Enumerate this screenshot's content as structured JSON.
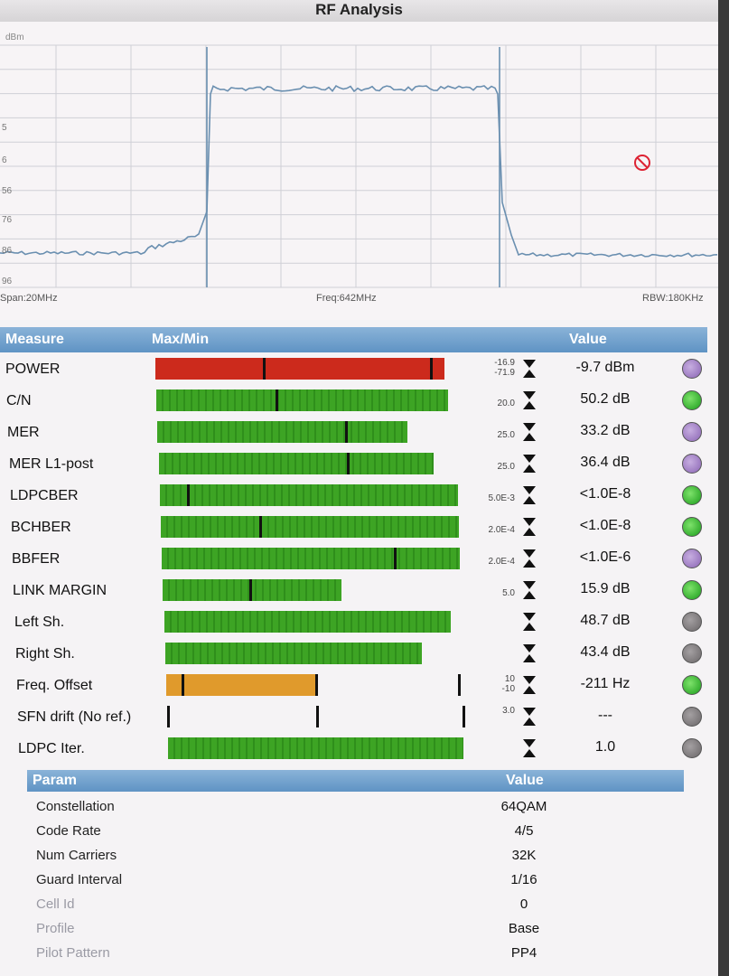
{
  "window_title": "RF Analysis",
  "spectrum": {
    "y_unit": "dBm",
    "y_ticks": [
      "5",
      "6",
      "56",
      "76",
      "86",
      "96"
    ],
    "span": "Span:20MHz",
    "freq": "Freq:642MHz",
    "rbw": "RBW:180KHz",
    "no_signal_icon": "prohibited-icon"
  },
  "measures": {
    "header": {
      "measure": "Measure",
      "maxmin": "Max/Min",
      "value": "Value"
    },
    "rows": [
      {
        "label": "POWER",
        "fill": 0.97,
        "color": "red",
        "markers": [
          0.36,
          0.92
        ],
        "max": "-16.9",
        "min": "-71.9",
        "value": "-9.7 dBm",
        "led": "purple"
      },
      {
        "label": "C/N",
        "fill": 0.98,
        "color": "green",
        "markers": [
          0.4
        ],
        "max": "",
        "min": "20.0",
        "value": "50.2 dB",
        "led": "green"
      },
      {
        "label": "MER",
        "fill": 0.84,
        "color": "green",
        "markers": [
          0.63
        ],
        "max": "",
        "min": "25.0",
        "value": "33.2 dB",
        "led": "purple"
      },
      {
        "label": "MER L1-post",
        "fill": 0.92,
        "color": "green",
        "markers": [
          0.63
        ],
        "max": "",
        "min": "25.0",
        "value": "36.4 dB",
        "led": "purple"
      },
      {
        "label": "LDPCBER",
        "fill": 1.0,
        "color": "green",
        "markers": [
          0.09
        ],
        "max": "",
        "min": "5.0E-3",
        "value": "<1.0E-8",
        "led": "green"
      },
      {
        "label": "BCHBER",
        "fill": 1.0,
        "color": "green",
        "markers": [
          0.33
        ],
        "max": "",
        "min": "2.0E-4",
        "value": "<1.0E-8",
        "led": "green"
      },
      {
        "label": "BBFER",
        "fill": 1.0,
        "color": "green",
        "markers": [
          0.78
        ],
        "max": "",
        "min": "2.0E-4",
        "value": "<1.0E-6",
        "led": "purple"
      },
      {
        "label": "LINK MARGIN",
        "fill": 0.6,
        "color": "green",
        "markers": [
          0.29
        ],
        "max": "",
        "min": "5.0",
        "value": "15.9 dB",
        "led": "green"
      },
      {
        "label": "Left Sh.",
        "fill": 0.96,
        "color": "green",
        "markers": [],
        "max": "",
        "min": "",
        "value": "48.7 dB",
        "led": "gray"
      },
      {
        "label": "Right Sh.",
        "fill": 0.86,
        "color": "green",
        "markers": [],
        "max": "",
        "min": "",
        "value": "43.4 dB",
        "led": "gray"
      },
      {
        "label": "Freq. Offset",
        "fill": 0.5,
        "color": "orange",
        "markers": [
          0.05,
          0.5,
          0.98
        ],
        "max": "10",
        "min": "-10",
        "value": "-211 Hz",
        "led": "green"
      },
      {
        "label": "SFN drift (No ref.)",
        "fill": 0,
        "color": "green",
        "markers": [
          0.0,
          0.5,
          1.0
        ],
        "max": "3.0",
        "min": "",
        "value": "---",
        "led": "gray"
      },
      {
        "label": "LDPC Iter.",
        "fill": 0.99,
        "color": "green",
        "markers": [],
        "max": "",
        "min": "",
        "value": "1.0",
        "led": "gray"
      }
    ]
  },
  "params": {
    "header": {
      "param": "Param",
      "value": "Value"
    },
    "rows": [
      {
        "label": "Constellation",
        "value": "64QAM",
        "dim": false
      },
      {
        "label": "Code Rate",
        "value": "4/5",
        "dim": false
      },
      {
        "label": "Num Carriers",
        "value": "32K",
        "dim": false
      },
      {
        "label": "Guard Interval",
        "value": "1/16",
        "dim": false
      },
      {
        "label": "Cell Id",
        "value": "0",
        "dim": true
      },
      {
        "label": "Profile",
        "value": "Base",
        "dim": true
      },
      {
        "label": "Pilot Pattern",
        "value": "PP4",
        "dim": true
      }
    ]
  }
}
